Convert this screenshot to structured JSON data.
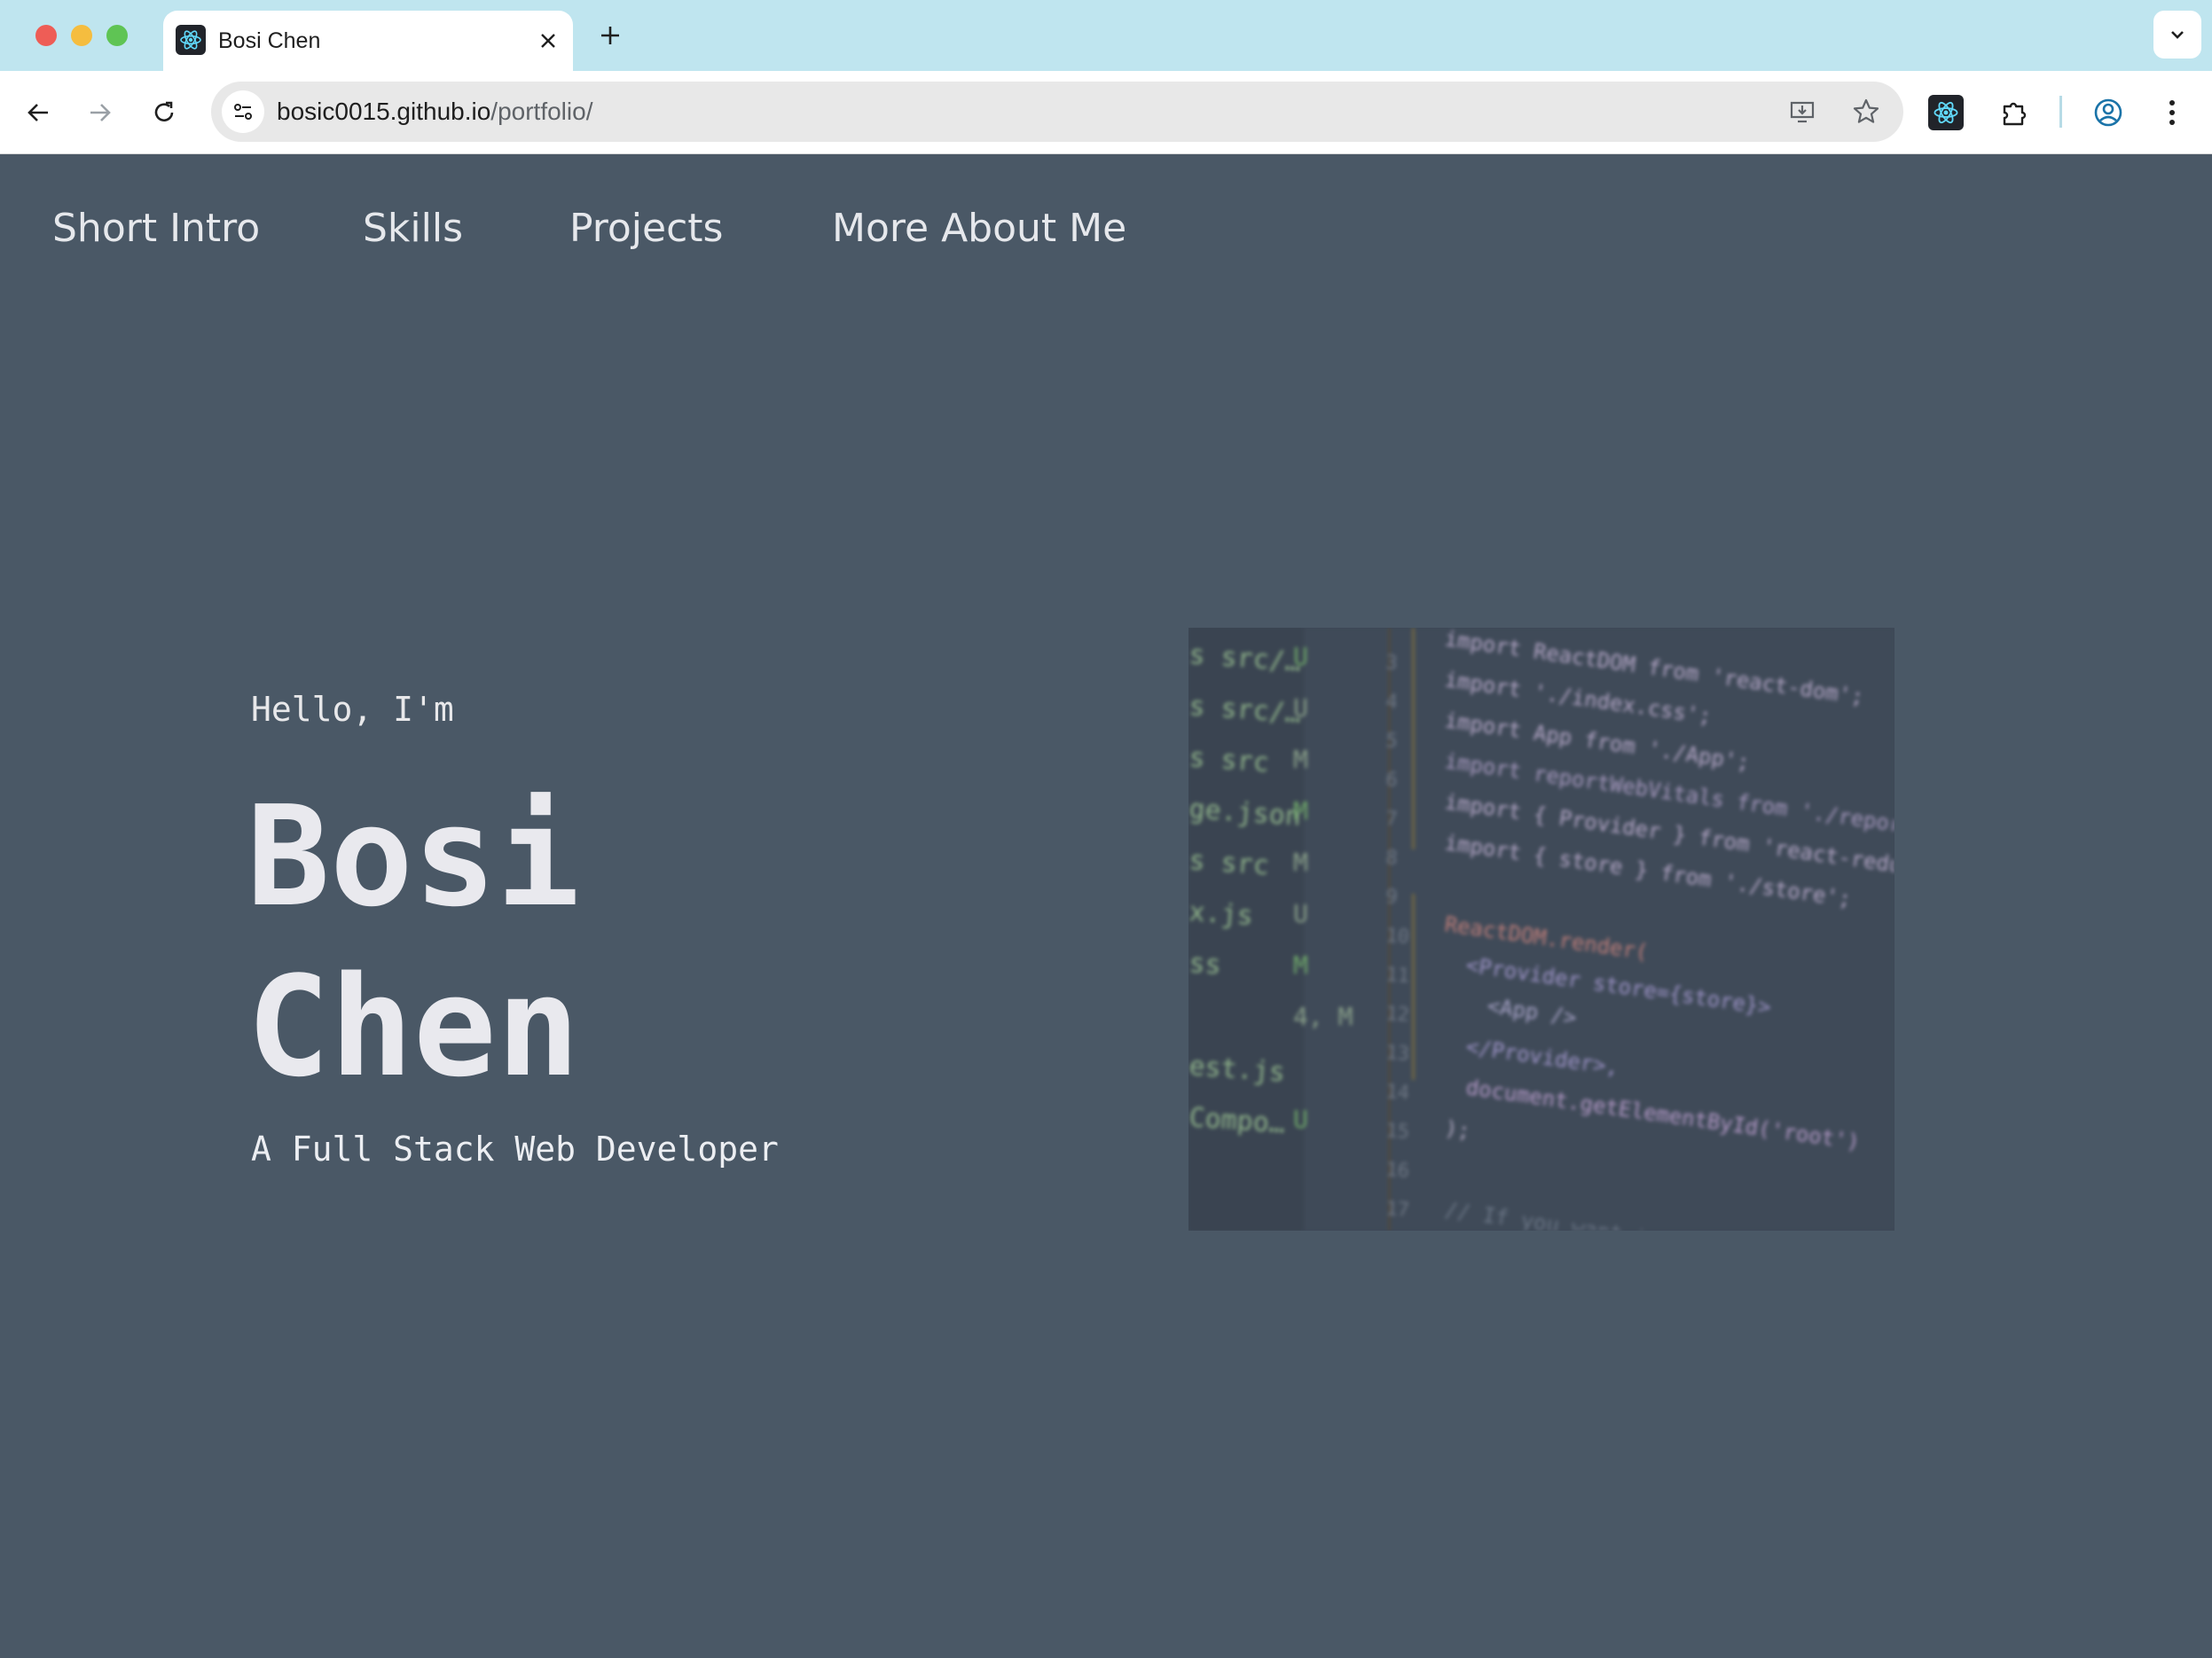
{
  "browser": {
    "tab": {
      "title": "Bosi Chen"
    },
    "address": {
      "host": "bosic0015.github.io",
      "path": "/portfolio/"
    }
  },
  "nav": {
    "links": [
      "Short Intro",
      "Skills",
      "Projects",
      "More About Me"
    ]
  },
  "hero": {
    "greeting": "Hello, I'm",
    "name_first": "Bosi",
    "name_last": "Chen",
    "role": "A Full Stack Web Developer"
  },
  "code_image": {
    "sidebar_files": [
      "s src/…",
      "s src/…",
      "s src",
      "ge.json",
      "s src",
      "x.js",
      "ss",
      "",
      "est.js",
      "Compo…"
    ],
    "sidebar_status": [
      "U",
      "U",
      "M",
      "M",
      "M",
      "U",
      "M",
      "4, M",
      "",
      "U"
    ],
    "line_numbers": [
      "3",
      "4",
      "5",
      "6",
      "7",
      "8",
      "9",
      "10",
      "11",
      "12",
      "13",
      "14",
      "15",
      "16",
      "17"
    ],
    "code_lines": [
      "import ReactDOM from 'react-dom';",
      "import './index.css';",
      "import App from './App';",
      "import reportWebVitals from './reportWebVitals';",
      "import { Provider } from 'react-redux';",
      "import { store } from './store';",
      "",
      "ReactDOM.render(",
      "  <Provider store={store}>",
      "    <App />",
      "  </Provider>,",
      "  document.getElementById('root')",
      ");",
      "",
      "// If you want to start measuring"
    ]
  },
  "colors": {
    "page_background": "#4a5866",
    "tabstrip": "#bfe5ef",
    "text_light": "#e8e8ea"
  },
  "icons": [
    "react-favicon-icon",
    "close-icon",
    "plus-icon",
    "chevron-down-icon",
    "back-arrow-icon",
    "forward-arrow-icon",
    "reload-icon",
    "site-settings-icon",
    "install-app-icon",
    "star-icon",
    "react-devtools-icon",
    "extensions-icon",
    "profile-icon",
    "more-vert-icon"
  ]
}
